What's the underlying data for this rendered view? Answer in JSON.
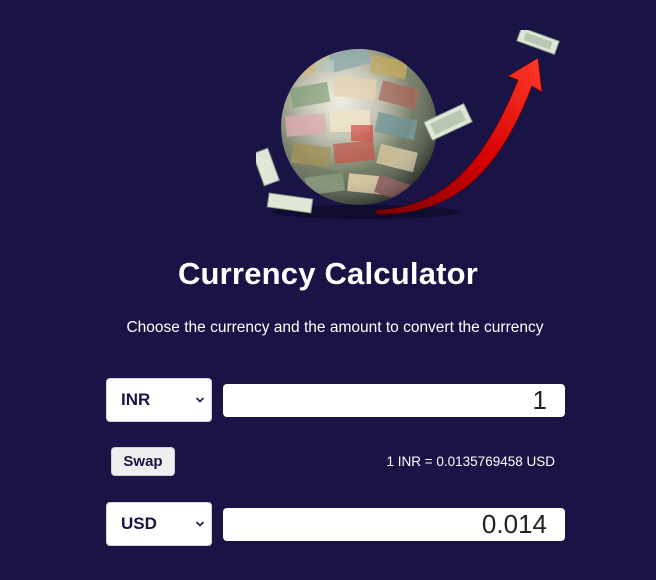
{
  "page": {
    "title": "Currency Calculator",
    "subtitle": "Choose the currency and the amount to convert the currency"
  },
  "from": {
    "currency": "INR",
    "amount": "1"
  },
  "to": {
    "currency": "USD",
    "amount": "0.014"
  },
  "swap_label": "Swap",
  "rate_text": "1 INR = 0.0135769458 USD",
  "colors": {
    "background": "#1a1446",
    "text": "#ffffff",
    "input_background": "#ffffff",
    "select_text": "#1a1446",
    "arrow": "#d40000"
  },
  "icons": {
    "hero": "money-globe-illustration",
    "select_chevron": "chevron-down-icon"
  }
}
